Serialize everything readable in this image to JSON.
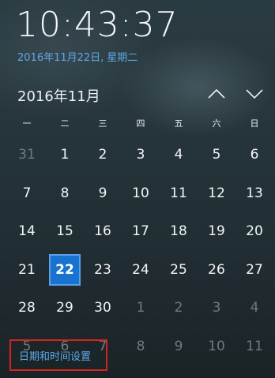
{
  "clock": {
    "time": "10:43:37",
    "date": "2016年11月22日, 星期二"
  },
  "calendar": {
    "month_title": "2016年11月",
    "nav_up_icon": "chevron-up-icon",
    "nav_down_icon": "chevron-down-icon",
    "weekdays": [
      "一",
      "二",
      "三",
      "四",
      "五",
      "六",
      "日"
    ],
    "days": [
      {
        "d": "31",
        "other": true
      },
      {
        "d": "1"
      },
      {
        "d": "2"
      },
      {
        "d": "3"
      },
      {
        "d": "4"
      },
      {
        "d": "5"
      },
      {
        "d": "6"
      },
      {
        "d": "7"
      },
      {
        "d": "8"
      },
      {
        "d": "9"
      },
      {
        "d": "10"
      },
      {
        "d": "11"
      },
      {
        "d": "12"
      },
      {
        "d": "13"
      },
      {
        "d": "14"
      },
      {
        "d": "15"
      },
      {
        "d": "16"
      },
      {
        "d": "17"
      },
      {
        "d": "18"
      },
      {
        "d": "19"
      },
      {
        "d": "20"
      },
      {
        "d": "21"
      },
      {
        "d": "22",
        "today": true
      },
      {
        "d": "23"
      },
      {
        "d": "24"
      },
      {
        "d": "25"
      },
      {
        "d": "26"
      },
      {
        "d": "27"
      },
      {
        "d": "28"
      },
      {
        "d": "29"
      },
      {
        "d": "30"
      },
      {
        "d": "1",
        "other": true
      },
      {
        "d": "2",
        "other": true
      },
      {
        "d": "3",
        "other": true
      },
      {
        "d": "4",
        "other": true
      },
      {
        "d": "5",
        "other": true
      },
      {
        "d": "6",
        "other": true
      },
      {
        "d": "7",
        "other": true
      },
      {
        "d": "8",
        "other": true
      },
      {
        "d": "9",
        "other": true
      },
      {
        "d": "10",
        "other": true
      },
      {
        "d": "11",
        "other": true
      }
    ]
  },
  "footer": {
    "settings_label": "日期和时间设置"
  },
  "colors": {
    "accent": "#1872d0",
    "link": "#5fa8e8",
    "highlight_border": "#d5241e"
  }
}
